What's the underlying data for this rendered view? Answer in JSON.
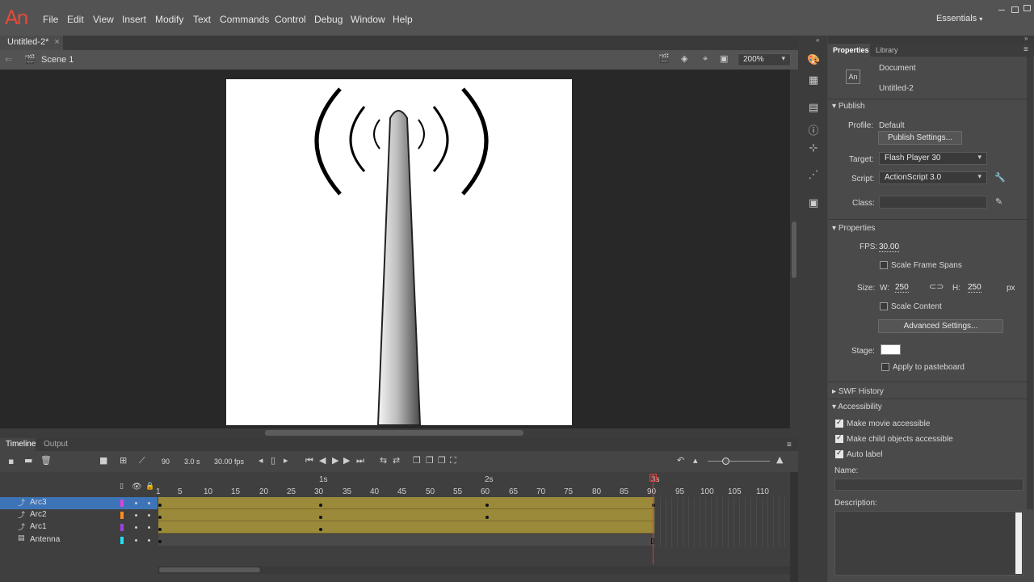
{
  "app": {
    "logo": "An",
    "workspace": "Essentials"
  },
  "menu": [
    "File",
    "Edit",
    "View",
    "Insert",
    "Modify",
    "Text",
    "Commands",
    "Control",
    "Debug",
    "Window",
    "Help"
  ],
  "doc_tab": {
    "label": "Untitled-2*",
    "close": "×"
  },
  "scene": {
    "label": "Scene 1",
    "zoom": "200%"
  },
  "timeline": {
    "tabs": [
      "Timeline",
      "Output"
    ],
    "frame": "90",
    "time": "3.0 s",
    "fps": "30.00 fps",
    "ruler_labels": [
      "1",
      "5",
      "10",
      "15",
      "20",
      "25",
      "30",
      "35",
      "40",
      "45",
      "50",
      "55",
      "60",
      "65",
      "70",
      "75",
      "80",
      "85",
      "90",
      "95",
      "100",
      "105",
      "110"
    ],
    "second_marks": [
      "1s",
      "2s",
      "3s"
    ],
    "layers": [
      {
        "name": "Arc3",
        "color": "#e040e0"
      },
      {
        "name": "Arc2",
        "color": "#ff8c1a"
      },
      {
        "name": "Arc1",
        "color": "#a040e0"
      },
      {
        "name": "Antenna",
        "color": "#20e0f0"
      }
    ]
  },
  "panel": {
    "tabs": [
      "Properties",
      "Library"
    ],
    "doc_type": "Document",
    "doc_name": "Untitled-2",
    "doc_icon": "An",
    "publish": {
      "header": "Publish",
      "profile_label": "Profile:",
      "profile_value": "Default",
      "settings_button": "Publish Settings...",
      "target_label": "Target:",
      "target_value": "Flash Player 30",
      "script_label": "Script:",
      "script_value": "ActionScript 3.0",
      "class_label": "Class:"
    },
    "properties": {
      "header": "Properties",
      "fps_label": "FPS:",
      "fps_value": "30.00",
      "scale_spans": "Scale Frame Spans",
      "size_label": "Size:",
      "w_label": "W:",
      "w_value": "250",
      "h_label": "H:",
      "h_value": "250",
      "unit": "px",
      "scale_content": "Scale Content",
      "advanced_button": "Advanced Settings...",
      "stage_label": "Stage:",
      "stage_color": "#ffffff",
      "apply_pasteboard": "Apply to pasteboard"
    },
    "swf_history": "SWF History",
    "accessibility": {
      "header": "Accessibility",
      "make_movie": "Make movie accessible",
      "make_child": "Make child objects accessible",
      "auto_label": "Auto label",
      "name_label": "Name:",
      "description_label": "Description:"
    }
  }
}
